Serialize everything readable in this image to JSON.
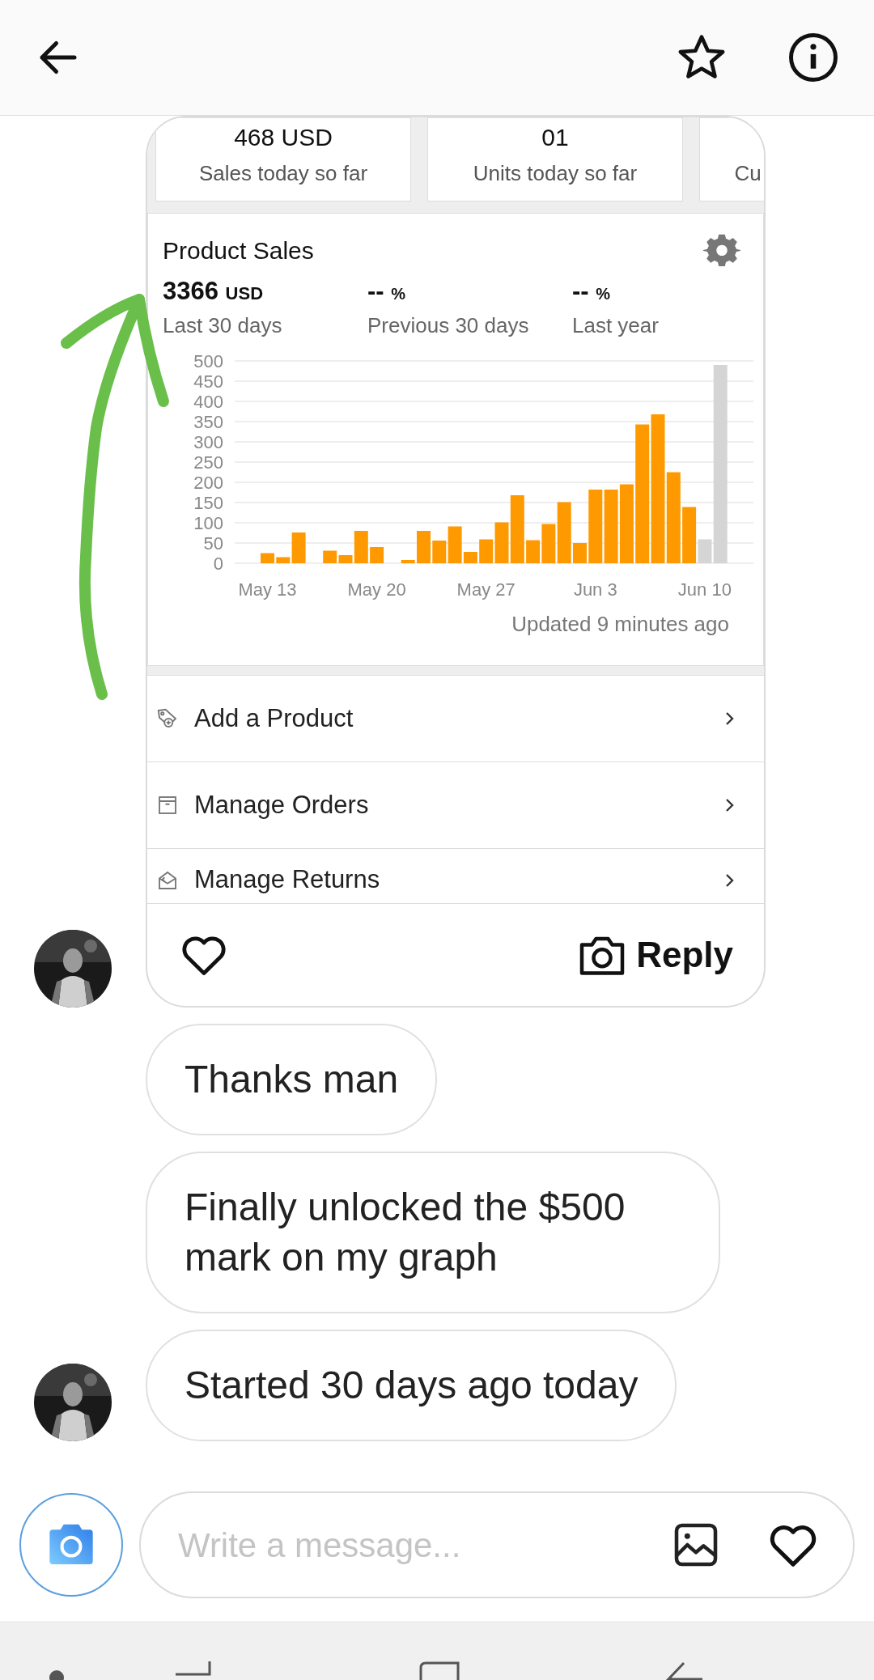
{
  "summary_tiles": [
    {
      "value": "468 USD",
      "label": "Sales today so far"
    },
    {
      "value": "01",
      "label": "Units today so far"
    },
    {
      "label": "Cu"
    }
  ],
  "product_sales": {
    "title": "Product Sales",
    "stats": [
      {
        "value": "3366",
        "unit": "USD",
        "label": "Last 30 days"
      },
      {
        "value": "--",
        "unit": "%",
        "label": "Previous 30 days"
      },
      {
        "value": "--",
        "unit": "%",
        "label": "Last year"
      }
    ],
    "chart_data": {
      "type": "bar",
      "grid": true,
      "categories": [
        "May 13",
        null,
        null,
        null,
        null,
        null,
        null,
        "May 20",
        null,
        null,
        null,
        null,
        null,
        null,
        "May 27",
        null,
        null,
        null,
        null,
        null,
        null,
        "Jun 3",
        null,
        null,
        null,
        null,
        null,
        null,
        "Jun 10",
        null
      ],
      "series": [
        {
          "color": "#ff9900",
          "values": [
            25,
            15,
            76,
            0,
            31,
            20,
            80,
            40,
            0,
            8,
            80,
            56,
            91,
            28,
            59,
            101,
            168,
            57,
            97,
            151,
            50,
            182,
            182,
            195,
            343,
            368,
            225,
            139,
            null,
            null
          ]
        },
        {
          "color": "#d5d5d5",
          "values": [
            null,
            null,
            null,
            null,
            null,
            null,
            null,
            null,
            null,
            null,
            null,
            null,
            null,
            null,
            null,
            null,
            null,
            null,
            null,
            null,
            null,
            null,
            null,
            null,
            null,
            null,
            null,
            null,
            59,
            490
          ]
        }
      ],
      "ylim": [
        0,
        500
      ],
      "yticks": [
        0,
        50,
        100,
        150,
        200,
        250,
        300,
        350,
        400,
        450,
        500
      ]
    },
    "updated": "Updated 9 minutes ago"
  },
  "menu_items": [
    {
      "label": "Add a Product"
    },
    {
      "label": "Manage Orders"
    },
    {
      "label": "Manage Returns"
    }
  ],
  "post": {
    "show_avatar": true,
    "reply": "Reply"
  },
  "messages": [
    {
      "text": "Thanks man",
      "show_avatar": false
    },
    {
      "text": "Finally unlocked the $500 mark on my graph",
      "show_avatar": false
    },
    {
      "text": "Started 30 days ago today",
      "show_avatar": true
    }
  ],
  "composer": {
    "placeholder": "Write a message..."
  }
}
